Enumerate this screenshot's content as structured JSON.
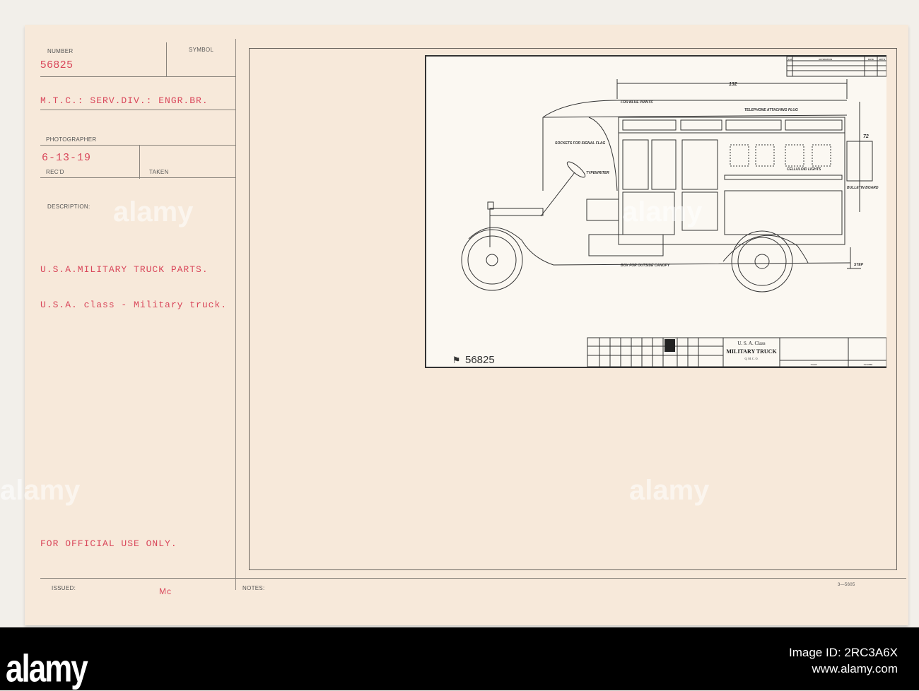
{
  "card": {
    "number_label": "NUMBER",
    "number": "56825",
    "symbol_label": "SYMBOL",
    "division": "M.T.C.: SERV.DIV.: ENGR.BR.",
    "photographer_label": "PHOTOGRAPHER",
    "received_date": "6-13-19",
    "received_label": "REC'D",
    "taken_label": "TAKEN",
    "description_label": "DESCRIPTION:",
    "description_line1": "U.S.A.MILITARY TRUCK PARTS.",
    "description_line2": "U.S.A. class - Military truck.",
    "official_use": "FOR OFFICIAL USE ONLY.",
    "issued_label": "ISSUED:",
    "issued_value": "Mc",
    "notes_label": "NOTES:",
    "form_number": "3—5605"
  },
  "drawing": {
    "dimension_length": "132",
    "dimension_height": "72",
    "labels": {
      "blue_prints": "FOR BLUE PRINTS",
      "telephone": "TELEPHONE ATTACHING PLUG",
      "sockets": "SOCKETS FOR SIGNAL FLAG",
      "typewriter": "TYPEWRITER",
      "celluloid": "CELLULOID LIGHTS",
      "bulletin": "BULLETIN BOARD",
      "box": "BOX FOR OUTSIDE CANOPY",
      "step": "STEP"
    },
    "alteration_header": [
      "LET.",
      "ALTERATION",
      "DATE",
      "APP'D"
    ],
    "title_block": {
      "class": "U. S. A. Class",
      "name": "MILITARY TRUCK",
      "office": "Q. M. C. O.",
      "name_label": "NAME",
      "number_label": "NUMBER"
    },
    "plate_number": "56825"
  },
  "watermark": {
    "brand": "alamy",
    "image_id": "Image ID: 2RC3A6X",
    "url": "www.alamy.com"
  }
}
